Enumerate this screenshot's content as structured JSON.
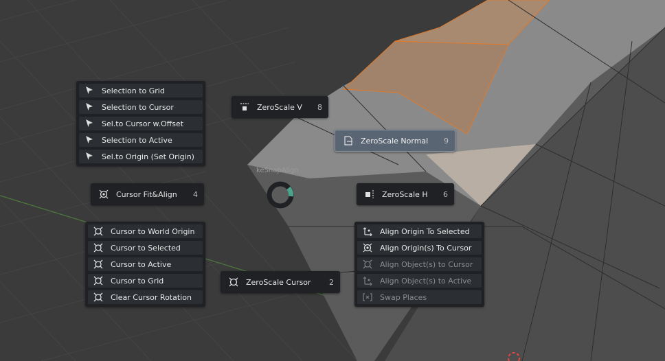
{
  "pie_menu": {
    "title": "keSnapAlign",
    "colors": {
      "panel": "#1f2124",
      "item": "#2b2e32",
      "active": "#5a6574",
      "ring_accent": "#4aa38a"
    }
  },
  "selection_menu": {
    "items": [
      {
        "label": "Selection to Grid",
        "icon": "cursor-arrow-icon"
      },
      {
        "label": "Selection to Cursor",
        "icon": "cursor-arrow-icon"
      },
      {
        "label": "Sel.to Cursor w.Offset",
        "icon": "cursor-arrow-icon"
      },
      {
        "label": "Selection to Active",
        "icon": "cursor-arrow-icon"
      },
      {
        "label": "Sel.to Origin (Set Origin)",
        "icon": "cursor-arrow-icon"
      }
    ]
  },
  "cursor_menu": {
    "items": [
      {
        "label": "Cursor to World Origin",
        "icon": "crosshair-icon"
      },
      {
        "label": "Cursor to Selected",
        "icon": "crosshair-icon"
      },
      {
        "label": "Cursor to Active",
        "icon": "crosshair-icon"
      },
      {
        "label": "Cursor to Grid",
        "icon": "crosshair-icon"
      },
      {
        "label": "Clear Cursor Rotation",
        "icon": "crosshair-icon"
      }
    ]
  },
  "origin_menu": {
    "items": [
      {
        "label": "Align Origin To Selected",
        "icon": "origin-move-icon",
        "enabled": true
      },
      {
        "label": "Align Origin(s) To Cursor",
        "icon": "origin-target-icon",
        "enabled": true
      },
      {
        "label": "Align Object(s) to Cursor",
        "icon": "crosshair-icon",
        "enabled": false
      },
      {
        "label": "Align Object(s) to Active",
        "icon": "origin-move-icon",
        "enabled": false
      },
      {
        "label": "Swap Places",
        "icon": "swap-icon",
        "enabled": false
      }
    ]
  },
  "pie_items": {
    "zeroscale_v": {
      "label": "ZeroScale V",
      "num": "8"
    },
    "zeroscale_normal": {
      "label": "ZeroScale Normal",
      "num": "9"
    },
    "cursor_fit": {
      "label": "Cursor Fit&Align",
      "num": "4"
    },
    "zeroscale_h": {
      "label": "ZeroScale H",
      "num": "6"
    },
    "zeroscale_cursor": {
      "label": "ZeroScale Cursor",
      "num": "2"
    }
  }
}
